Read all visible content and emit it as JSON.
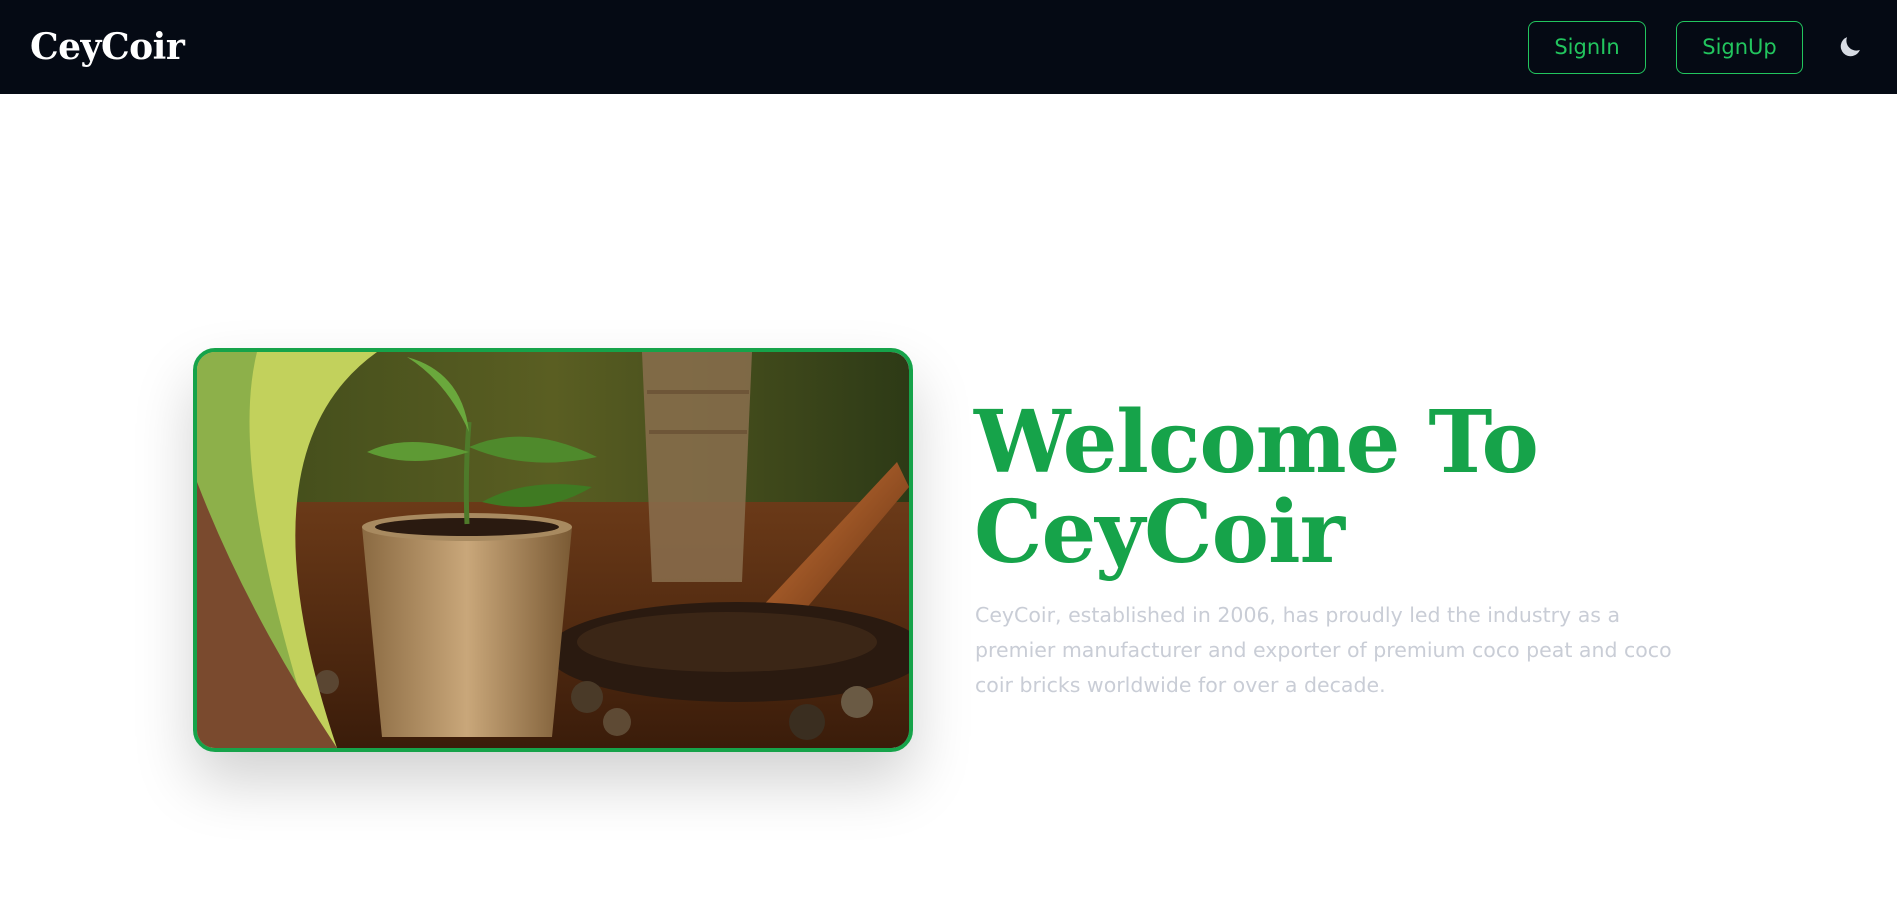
{
  "header": {
    "brand": "CeyCoir",
    "signin_label": "SignIn",
    "signup_label": "SignUp",
    "theme_icon": "moon-icon"
  },
  "hero": {
    "title_line1": "Welcome To",
    "title_line2": "CeyCoir",
    "description": "CeyCoir, established in 2006, has proudly led the industry as a premier manufacturer and exporter of premium coco peat and coco coir bricks worldwide for over a decade.",
    "image_alt": "seedling in coir pot with soil and trowel"
  },
  "colors": {
    "accent": "#16a34a",
    "navbar_bg": "#050a14",
    "button_text": "#22c55e",
    "description_text": "#c9cdd6"
  }
}
